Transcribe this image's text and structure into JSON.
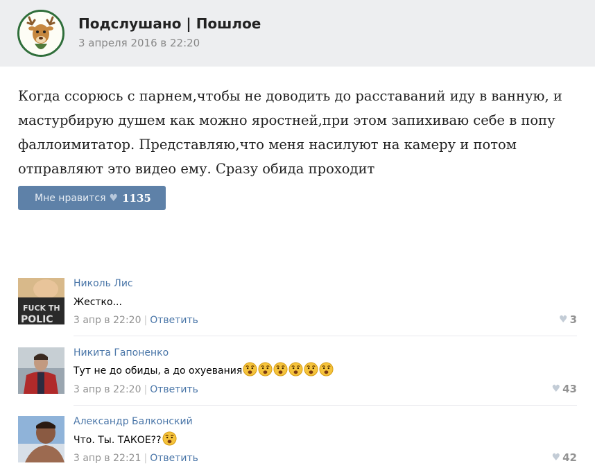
{
  "post": {
    "group_name": "Подслушано | Пошлое",
    "date": "3 апреля 2016 в 22:20",
    "text": "Когда ссорюсь с парнем,чтобы не доводить до расставаний иду в ванную, и мастурбирую душем как можно яростней,при этом запихиваю себе в попу фаллоимитатор. Представляю,что меня насилуют на камеру и потом отправляют это видео ему. Сразу обида проходит",
    "like_label": "Мне нравится",
    "like_count": "1135"
  },
  "comments": [
    {
      "author": "Николь Лис",
      "text": "Жестко...",
      "date": "3 апр в 22:20",
      "reply": "Ответить",
      "likes": "3",
      "emoji_count": 0
    },
    {
      "author": "Никита Гапоненко",
      "text": "Тут не до обиды, а до охуевания",
      "date": "3 апр в 22:20",
      "reply": "Ответить",
      "likes": "43",
      "emoji_count": 6
    },
    {
      "author": "Александр Балконский",
      "text": "Что. Ты. ТАКОЕ??",
      "date": "3 апр в 22:21",
      "reply": "Ответить",
      "likes": "42",
      "emoji_count": 1
    }
  ],
  "colors": {
    "link": "#4a76a8",
    "button": "#5e81a8",
    "header_bg": "#edeef0",
    "meta": "#939393"
  },
  "icons": {
    "like": "heart-icon",
    "emoji": "shocked-face-emoji"
  },
  "avatar_text": "FUCK TH POLIC"
}
